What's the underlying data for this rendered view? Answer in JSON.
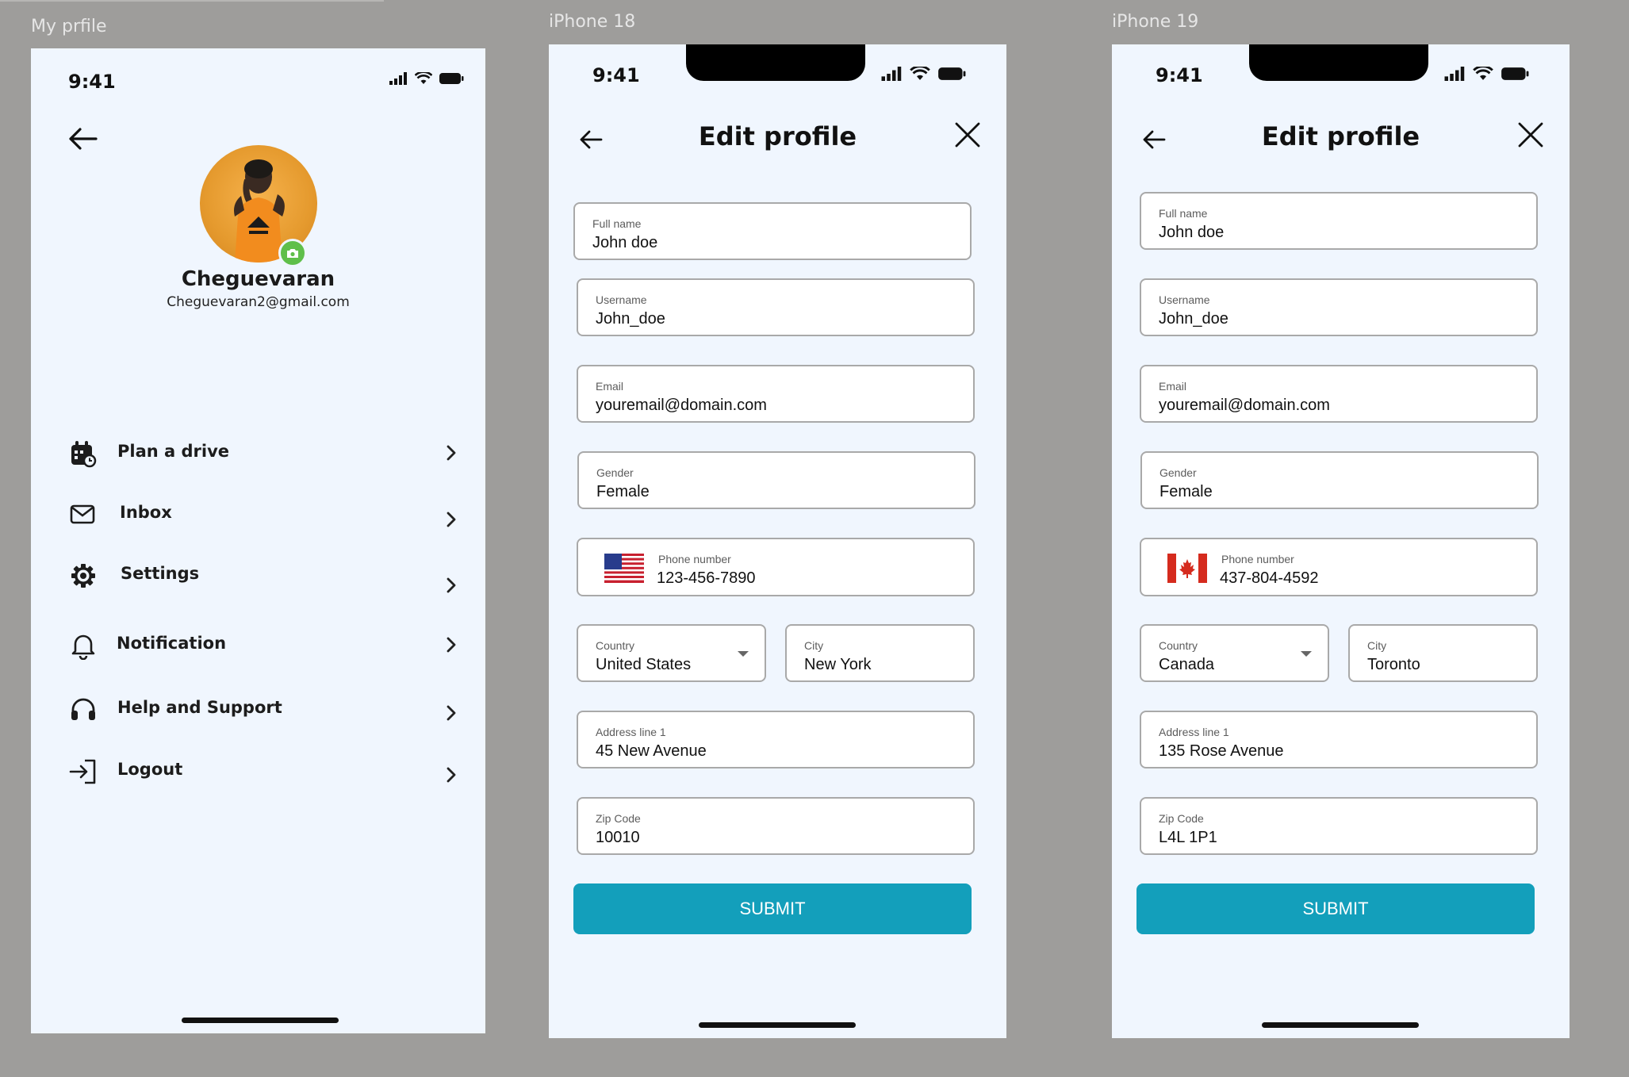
{
  "frames": {
    "profile_label": "My prfile",
    "edit1_label": "iPhone 18",
    "edit2_label": "iPhone 19"
  },
  "status": {
    "time": "9:41"
  },
  "profile": {
    "name": "Cheguevaran",
    "email": "Cheguevaran2@gmail.com",
    "menu": [
      {
        "label": "Plan a drive",
        "icon": "calendar-icon"
      },
      {
        "label": "Inbox",
        "icon": "mail-icon"
      },
      {
        "label": "Settings",
        "icon": "gear-icon"
      },
      {
        "label": "Notification",
        "icon": "bell-icon"
      },
      {
        "label": "Help and Support",
        "icon": "headset-icon"
      },
      {
        "label": "Logout",
        "icon": "logout-icon"
      }
    ]
  },
  "edit_us": {
    "title": "Edit profile",
    "full_name_label": "Full name",
    "full_name": "John doe",
    "username_label": "Username",
    "username": "John_doe",
    "email_label": "Email",
    "email": "youremail@domain.com",
    "gender_label": "Gender",
    "gender": "Female",
    "phone_label": "Phone number",
    "phone": "123-456-7890",
    "flag": "us-flag-icon",
    "country_label": "Country",
    "country": "United States",
    "city_label": "City",
    "city": "New York",
    "address_label": "Address line 1",
    "address": "45 New Avenue",
    "zip_label": "Zip Code",
    "zip": "10010",
    "submit": "SUBMIT"
  },
  "edit_ca": {
    "title": "Edit profile",
    "full_name_label": "Full name",
    "full_name": "John doe",
    "username_label": "Username",
    "username": "John_doe",
    "email_label": "Email",
    "email": "youremail@domain.com",
    "gender_label": "Gender",
    "gender": "Female",
    "phone_label": "Phone number",
    "phone": "437-804-4592",
    "flag": "canada-flag-icon",
    "country_label": "Country",
    "country": "Canada",
    "city_label": "City",
    "city": "Toronto",
    "address_label": "Address line 1",
    "address": "135 Rose Avenue",
    "zip_label": "Zip Code",
    "zip": "L4L 1P1",
    "submit": "SUBMIT"
  },
  "colors": {
    "screen_bg": "#f0f6fe",
    "accent": "#139fbb",
    "canvas": "#9e9d9b"
  }
}
